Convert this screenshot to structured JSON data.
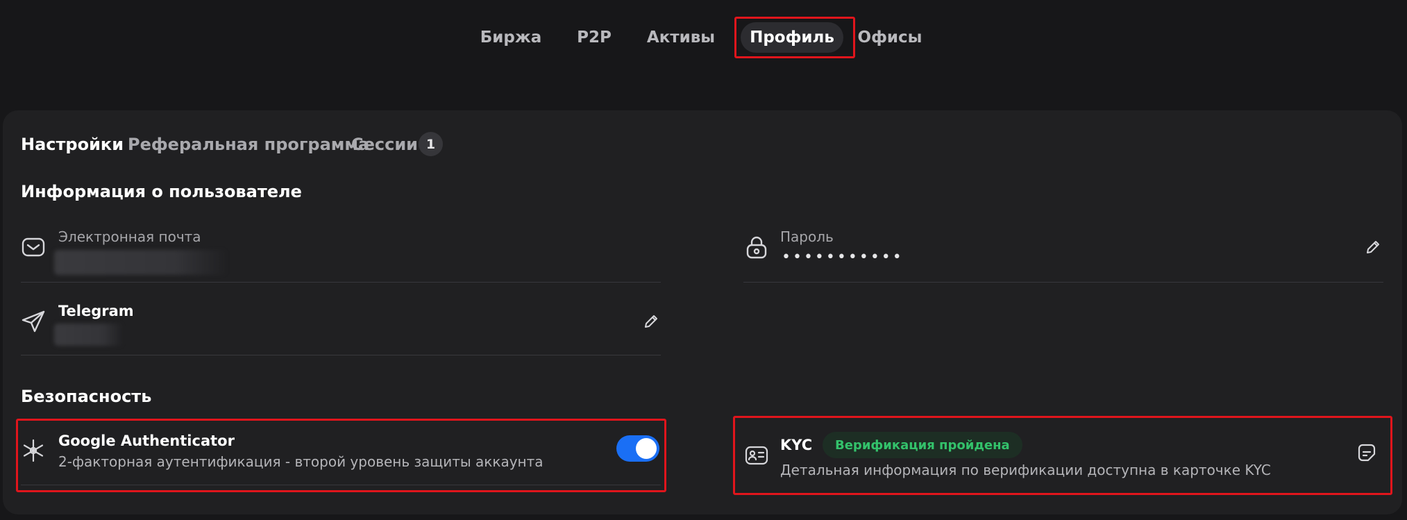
{
  "topnav": {
    "items": [
      {
        "label": "Биржа"
      },
      {
        "label": "P2P"
      },
      {
        "label": "Активы"
      },
      {
        "label": "Профиль",
        "active": true
      },
      {
        "label": "Офисы"
      }
    ]
  },
  "subtabs": {
    "items": [
      {
        "label": "Настройки",
        "active": true
      },
      {
        "label": "Реферальная программа"
      },
      {
        "label": "Сессии"
      }
    ],
    "sessions_count": "1"
  },
  "user_info": {
    "title": "Информация о пользователе",
    "email": {
      "label": "Электронная почта",
      "icon": "mail-icon"
    },
    "password": {
      "label": "Пароль",
      "value": "•••••••••••",
      "icon": "lock-icon"
    },
    "telegram": {
      "label": "Telegram",
      "icon": "telegram-icon"
    }
  },
  "security": {
    "title": "Безопасность",
    "google_auth": {
      "title": "Google Authenticator",
      "description": "2-факторная аутентификация - второй уровень защиты аккаунта",
      "enabled": true,
      "icon": "authenticator-icon"
    },
    "kyc": {
      "title": "KYC",
      "status": "Верификация пройдена",
      "description": "Детальная информация по верификации доступна в карточке KYC",
      "icon": "id-card-icon"
    }
  },
  "colors": {
    "background": "#171719",
    "card": "#202022",
    "accent": "#1a6ff5",
    "success": "#33c26b",
    "highlight": "#e0151c"
  }
}
